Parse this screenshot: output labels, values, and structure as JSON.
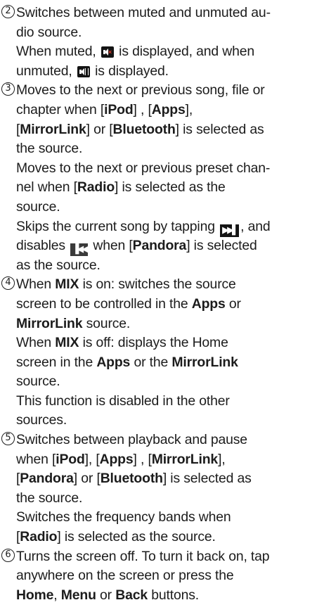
{
  "items": [
    {
      "num": "2",
      "lines": [
        [
          "Switches between muted and unmuted au-"
        ],
        [
          "dio source."
        ],
        [
          "When muted, ",
          {
            "icon": "mute-icon"
          },
          " is displayed, and when"
        ],
        [
          "unmuted, ",
          {
            "icon": "unmute-icon"
          },
          " is displayed."
        ]
      ]
    },
    {
      "num": "3",
      "lines": [
        [
          "Moves to the next or previous song, file or"
        ],
        [
          "chapter when [",
          {
            "b": "iPod"
          },
          "] , [",
          {
            "b": "Apps"
          },
          "],"
        ],
        [
          "[",
          {
            "b": "MirrorLink"
          },
          "] or [",
          {
            "b": "Bluetooth"
          },
          "] is selected as"
        ],
        [
          "the source."
        ],
        [
          "Moves to the next or previous preset chan-"
        ],
        [
          "nel when [",
          {
            "b": "Radio"
          },
          "] is selected as the"
        ],
        [
          "source."
        ],
        [
          "Skips the current song by tapping ",
          {
            "icon": "skip-next-icon"
          },
          ", and"
        ],
        [
          "disables ",
          {
            "icon": "skip-previous-icon"
          },
          " when [",
          {
            "b": "Pandora"
          },
          "] is selected"
        ],
        [
          "as the source."
        ]
      ]
    },
    {
      "num": "4",
      "lines": [
        [
          "When ",
          {
            "b": "MIX"
          },
          " is on: switches the source"
        ],
        [
          "screen to be controlled in the ",
          {
            "b": "Apps"
          },
          " or"
        ],
        [
          {
            "b": "MirrorLink"
          },
          " source."
        ],
        [
          "When ",
          {
            "b": "MIX"
          },
          " is off: displays the Home"
        ],
        [
          "screen in the ",
          {
            "b": "Apps"
          },
          " or the ",
          {
            "b": "MirrorLink"
          }
        ],
        [
          "source."
        ],
        [
          "This function is disabled in the other"
        ],
        [
          "sources."
        ]
      ]
    },
    {
      "num": "5",
      "lines": [
        [
          "Switches between playback and pause"
        ],
        [
          "when [",
          {
            "b": "iPod"
          },
          "], [",
          {
            "b": "Apps"
          },
          "] , [",
          {
            "b": "MirrorLink"
          },
          "],"
        ],
        [
          "[",
          {
            "b": "Pandora"
          },
          "] or [",
          {
            "b": "Bluetooth"
          },
          "] is selected as"
        ],
        [
          "the source."
        ],
        [
          "Switches the frequency bands when"
        ],
        [
          "[",
          {
            "b": "Radio"
          },
          "] is selected as the source."
        ]
      ]
    },
    {
      "num": "6",
      "lines": [
        [
          "Turns the screen off. To turn it back on, tap"
        ],
        [
          "anywhere on the screen or press the"
        ],
        [
          {
            "b": "Home"
          },
          ", ",
          {
            "b": "Menu"
          },
          " or ",
          {
            "b": "Back"
          },
          " buttons."
        ]
      ]
    }
  ]
}
